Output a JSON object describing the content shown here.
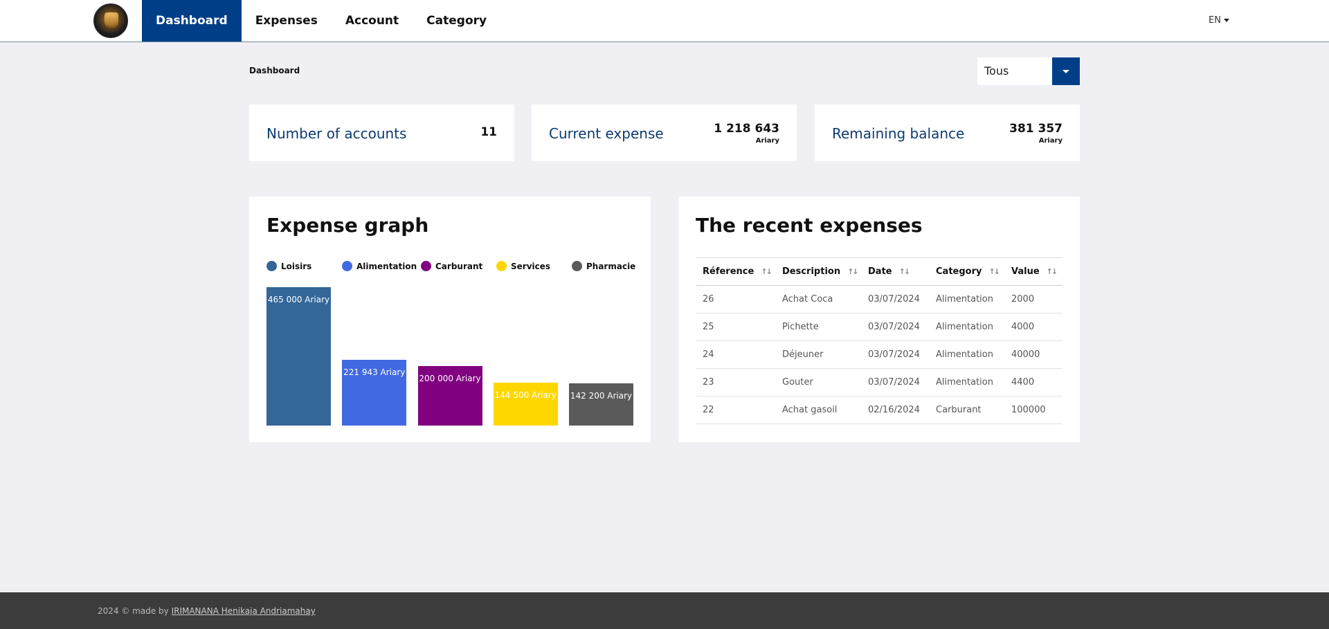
{
  "nav": {
    "items": [
      {
        "label": "Dashboard",
        "active": true
      },
      {
        "label": "Expenses",
        "active": false
      },
      {
        "label": "Account",
        "active": false
      },
      {
        "label": "Category",
        "active": false
      }
    ],
    "language": "EN"
  },
  "breadcrumb": "Dashboard",
  "filter": {
    "selected": "Tous"
  },
  "stats": {
    "accounts": {
      "label": "Number of accounts",
      "value": "11"
    },
    "current": {
      "label": "Current expense",
      "value": "1 218 643",
      "unit": "Ariary"
    },
    "remaining": {
      "label": "Remaining balance",
      "value": "381 357",
      "unit": "Ariary"
    }
  },
  "graph": {
    "title": "Expense graph",
    "legend": [
      {
        "label": "Loisirs",
        "color": "#336699"
      },
      {
        "label": "Alimentation",
        "color": "#4169e1"
      },
      {
        "label": "Carburant",
        "color": "#800080"
      },
      {
        "label": "Services",
        "color": "#ffd700"
      },
      {
        "label": "Pharmacie",
        "color": "#5a5a5a"
      }
    ]
  },
  "chart_data": {
    "type": "bar",
    "categories": [
      "Loisirs",
      "Alimentation",
      "Carburant",
      "Services",
      "Pharmacie"
    ],
    "values": [
      465000,
      221943,
      200000,
      144500,
      142200
    ],
    "data_labels": [
      "465 000 Ariary",
      "221 943 Ariary",
      "200 000 Ariary",
      "144 500 Ariary",
      "142 200 Ariary"
    ],
    "colors": [
      "#336699",
      "#4169e1",
      "#800080",
      "#ffd700",
      "#5a5a5a"
    ],
    "title": "Expense graph",
    "legend": "top"
  },
  "recent": {
    "title": "The recent expenses",
    "columns": [
      "Réference",
      "Description",
      "Date",
      "Category",
      "Value"
    ],
    "rows": [
      [
        "26",
        "Achat Coca",
        "03/07/2024",
        "Alimentation",
        "2000"
      ],
      [
        "25",
        "Pichette",
        "03/07/2024",
        "Alimentation",
        "4000"
      ],
      [
        "24",
        "Déjeuner",
        "03/07/2024",
        "Alimentation",
        "40000"
      ],
      [
        "23",
        "Gouter",
        "03/07/2024",
        "Alimentation",
        "4400"
      ],
      [
        "22",
        "Achat gasoil",
        "02/16/2024",
        "Carburant",
        "100000"
      ]
    ]
  },
  "footer": {
    "prefix": "2024 © made by",
    "author": "IRIMANANA Henikaja Andriamahay"
  }
}
